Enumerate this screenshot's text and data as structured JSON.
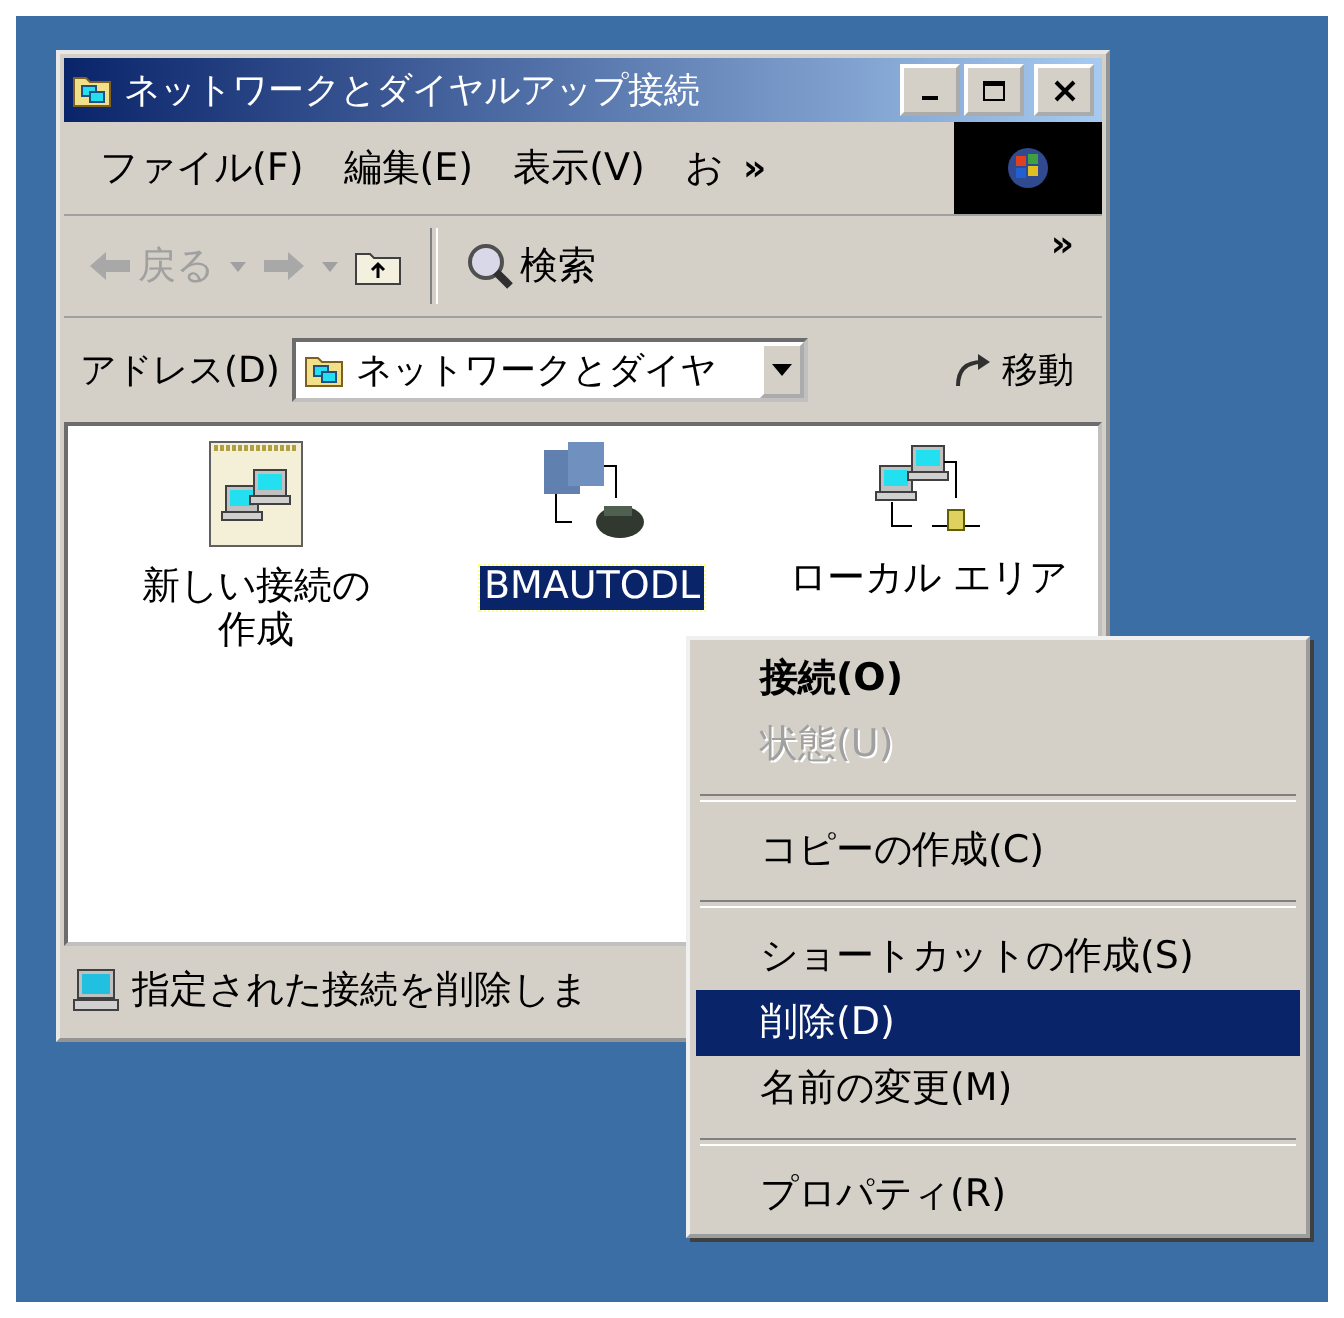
{
  "window": {
    "title": "ネットワークとダイヤルアップ接続"
  },
  "menu_bar": {
    "items": [
      "ファイル(F)",
      "編集(E)",
      "表示(V)",
      "お"
    ],
    "overflow": "»"
  },
  "toolbar": {
    "back": {
      "label": "戻る",
      "disabled": true
    },
    "forward": {
      "disabled": true
    },
    "search": "検索",
    "overflow": "»"
  },
  "address_bar": {
    "label": "アドレス(D)",
    "value": "ネットワークとダイヤ",
    "go": "移動"
  },
  "icons": [
    {
      "kind": "new",
      "label": "新しい接続の作成",
      "selected": false
    },
    {
      "kind": "dialup",
      "label": "BMAUTODL",
      "selected": true
    },
    {
      "kind": "lan",
      "label": "ローカル エリア",
      "selected": false
    }
  ],
  "status_bar": {
    "text": "指定された接続を削除しま"
  },
  "context_menu": {
    "groups": [
      [
        {
          "label": "接続(O)",
          "default": true,
          "disabled": false,
          "selected": false
        },
        {
          "label": "状態(U)",
          "default": false,
          "disabled": true,
          "selected": false
        }
      ],
      [
        {
          "label": "コピーの作成(C)",
          "default": false,
          "disabled": false,
          "selected": false
        }
      ],
      [
        {
          "label": "ショートカットの作成(S)",
          "default": false,
          "disabled": false,
          "selected": false
        },
        {
          "label": "削除(D)",
          "default": false,
          "disabled": false,
          "selected": true
        },
        {
          "label": "名前の変更(M)",
          "default": false,
          "disabled": false,
          "selected": false
        }
      ],
      [
        {
          "label": "プロパティ(R)",
          "default": false,
          "disabled": false,
          "selected": false
        }
      ]
    ]
  }
}
